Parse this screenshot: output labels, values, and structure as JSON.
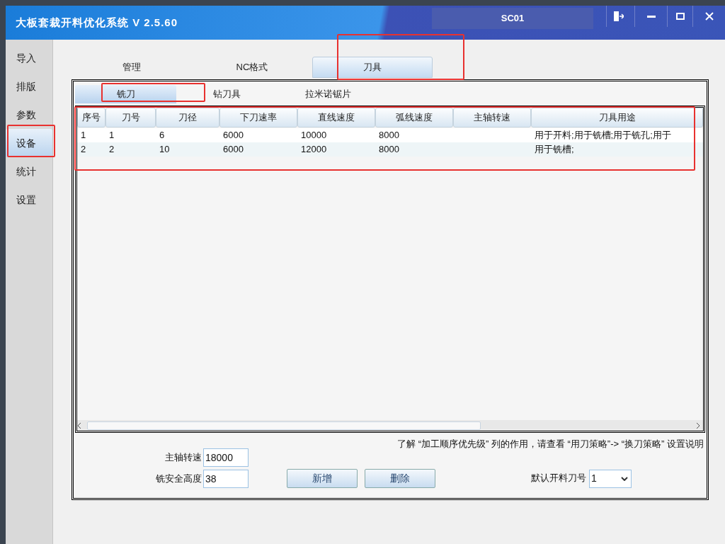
{
  "window": {
    "title": "大板套裁开料优化系统 V 2.5.60",
    "user": "SC01"
  },
  "sidebar": {
    "items": [
      {
        "label": "导入",
        "selected": false
      },
      {
        "label": "排版",
        "selected": false
      },
      {
        "label": "参数",
        "selected": false
      },
      {
        "label": "设备",
        "selected": true
      },
      {
        "label": "统计",
        "selected": false
      },
      {
        "label": "设置",
        "selected": false
      }
    ]
  },
  "tabs": [
    {
      "label": "管理",
      "selected": false
    },
    {
      "label": "NC格式",
      "selected": false
    },
    {
      "label": "刀具",
      "selected": true
    }
  ],
  "sub_tabs": [
    {
      "label": "铣刀",
      "selected": true
    },
    {
      "label": "钻刀具",
      "selected": false
    },
    {
      "label": "拉米诺锯片",
      "selected": false
    }
  ],
  "table": {
    "columns": [
      "序号",
      "刀号",
      "刀径",
      "下刀速率",
      "直线速度",
      "弧线速度",
      "主轴转速",
      "刀具用途"
    ],
    "rows": [
      [
        "1",
        "1",
        "6",
        "6000",
        "10000",
        "8000",
        "",
        "用于开料;用于铣槽;用于铣孔;用于"
      ],
      [
        "2",
        "2",
        "10",
        "6000",
        "12000",
        "8000",
        "",
        "用于铣槽;"
      ]
    ]
  },
  "note": "了解 “加工顺序优先级” 列的作用，请查看 “用刀策略”-> “换刀策略” 设置说明",
  "fields": [
    {
      "label": "主轴转速",
      "value": "18000"
    },
    {
      "label": "铣安全高度",
      "value": "38"
    }
  ],
  "buttons": [
    "新增",
    "删除"
  ],
  "default_tool": {
    "label": "默认开料刀号",
    "value": "1"
  }
}
